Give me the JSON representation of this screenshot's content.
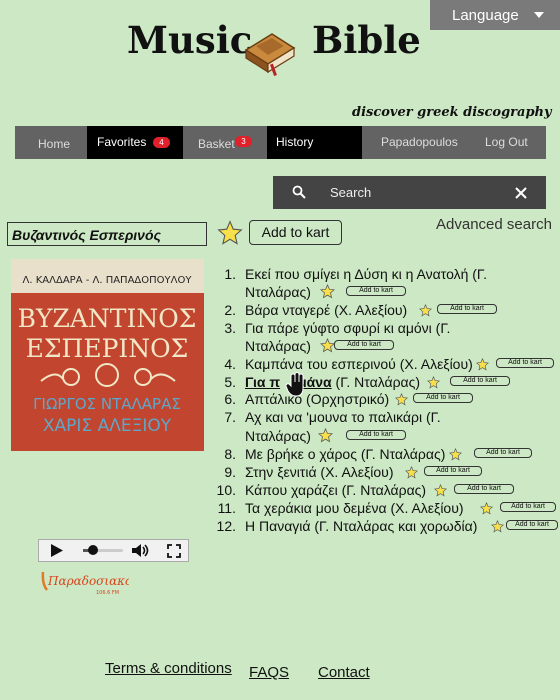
{
  "header": {
    "language_label": "Language",
    "logo_word_1": "Music",
    "logo_word_2": "Bible",
    "tagline": "discover greek discography"
  },
  "nav": {
    "home": "Home",
    "favorites": "Favorites",
    "favorites_count": "4",
    "basket": "Basket",
    "basket_count": "3",
    "history": "History",
    "user": "Papadopoulos",
    "logout": "Log Out"
  },
  "search": {
    "placeholder": "Search",
    "advanced": "Advanced search"
  },
  "album": {
    "title": "Βυζαντινός Εσπερινός",
    "add_label": "Add to kart",
    "cover_top": "Λ. ΚΑΛΔΑΡΑ - Λ. ΠΑΠΑΔΟΠΟΥΛΟΥ",
    "cover_title_1": "ΒΥΖΑΝΤΙΝΟΣ",
    "cover_title_2": "ΕΣΠΕΡΙΝΟΣ",
    "cover_artist_1": "ΓΙΩΡΓΟΣ ΝΤΑΛΑΡΑΣ",
    "cover_artist_2": "ΧΑΡΙΣ ΑΛΕΞΙΟΥ"
  },
  "tracks": [
    {
      "num": "1.",
      "line1": "Εκεί που σμίγει η Δύση κι η Ανατολή (Γ.",
      "line2": "Νταλάρας)"
    },
    {
      "num": "2.",
      "line1": "Βάρα νταγερέ (Χ. Αλεξίου)"
    },
    {
      "num": "3.",
      "line1": "Για πάρε γύφτο σφυρί κι αμόνι (Γ.",
      "line2": "Νταλάρας)"
    },
    {
      "num": "4.",
      "line1": "Καμπάνα του εσπερινού (Χ. Αλεξίου)"
    },
    {
      "num": "5.",
      "line1": "Για π",
      "line1b": "μάνα",
      "line1c": " (Γ. Νταλάρας)"
    },
    {
      "num": "6.",
      "line1": "Απτάλικο (Ορχηστρικό)"
    },
    {
      "num": "7.",
      "line1": "Αχ και να 'μουνα το παλικάρι (Γ.",
      "line2": "Νταλάρας)"
    },
    {
      "num": "8.",
      "line1": "Με βρήκε ο χάρος (Γ. Νταλάρας)"
    },
    {
      "num": "9.",
      "line1": "Στην ξενιτιά (Χ. Αλεξίου)"
    },
    {
      "num": "10.",
      "line1": "Κάπου χαράζει (Γ. Νταλάρας)"
    },
    {
      "num": "11.",
      "line1": "Τα χεράκια μου δεμένα (Χ. Αλεξίου)"
    },
    {
      "num": "12.",
      "line1": "Η Παναγιά (Γ. Νταλάρας και χορωδία)"
    }
  ],
  "track_add_label": "Add to kart",
  "player": {
    "progress": 0.25,
    "volume_icon": "volume-icon",
    "fullscreen_icon": "fullscreen-icon"
  },
  "radio_logo": {
    "name": "Παραδοσιακός",
    "freq": "106.6 FM"
  },
  "footer": {
    "terms": "Terms & conditions",
    "faqs": "FAQS",
    "contact": "Contact"
  },
  "colors": {
    "background": "#cce8c4",
    "nav_bar": "#636363",
    "badge": "#e0202a",
    "star": "#f7e04a"
  }
}
